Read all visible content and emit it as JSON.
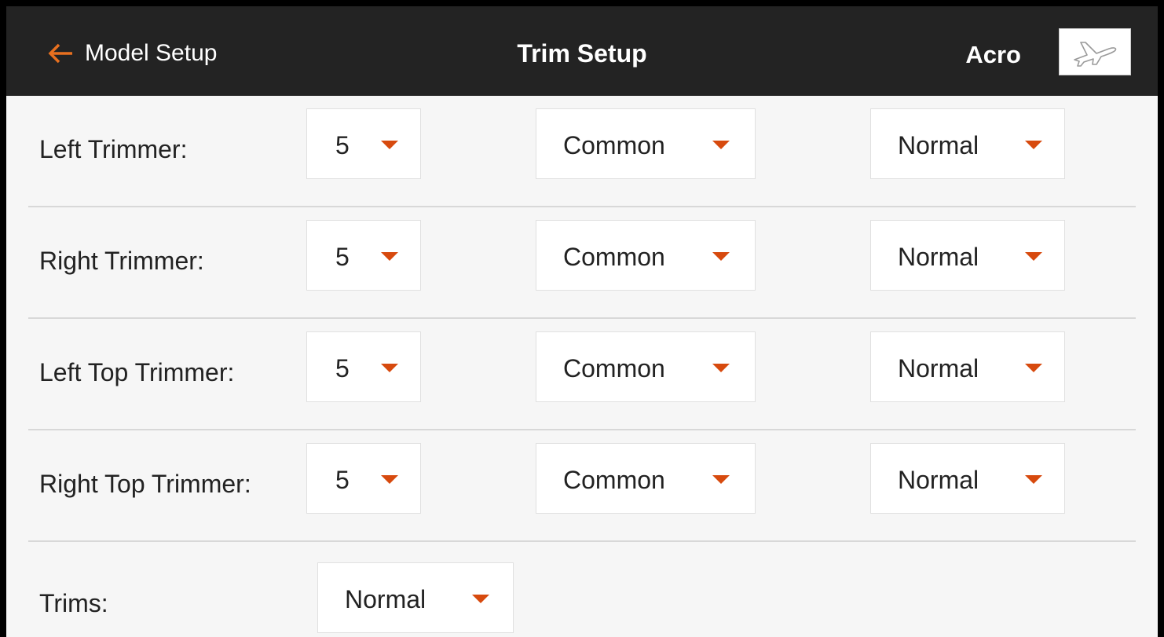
{
  "header": {
    "back_label": "Model Setup",
    "title": "Trim Setup",
    "mode": "Acro",
    "back_icon": "arrow-left-icon",
    "model_icon": "airplane-icon",
    "accent_color": "#e8701f"
  },
  "rows": [
    {
      "label": "Left Trimmer:",
      "steps": "5",
      "type": "Common",
      "mode": "Normal"
    },
    {
      "label": "Right Trimmer:",
      "steps": "5",
      "type": "Common",
      "mode": "Normal"
    },
    {
      "label": "Left Top Trimmer:",
      "steps": "5",
      "type": "Common",
      "mode": "Normal"
    },
    {
      "label": "Right Top Trimmer:",
      "steps": "5",
      "type": "Common",
      "mode": "Normal"
    }
  ],
  "trims": {
    "label": "Trims:",
    "value": "Normal"
  },
  "colors": {
    "caret": "#d74a0e",
    "header_bg": "#232323",
    "body_bg": "#f6f6f6"
  }
}
